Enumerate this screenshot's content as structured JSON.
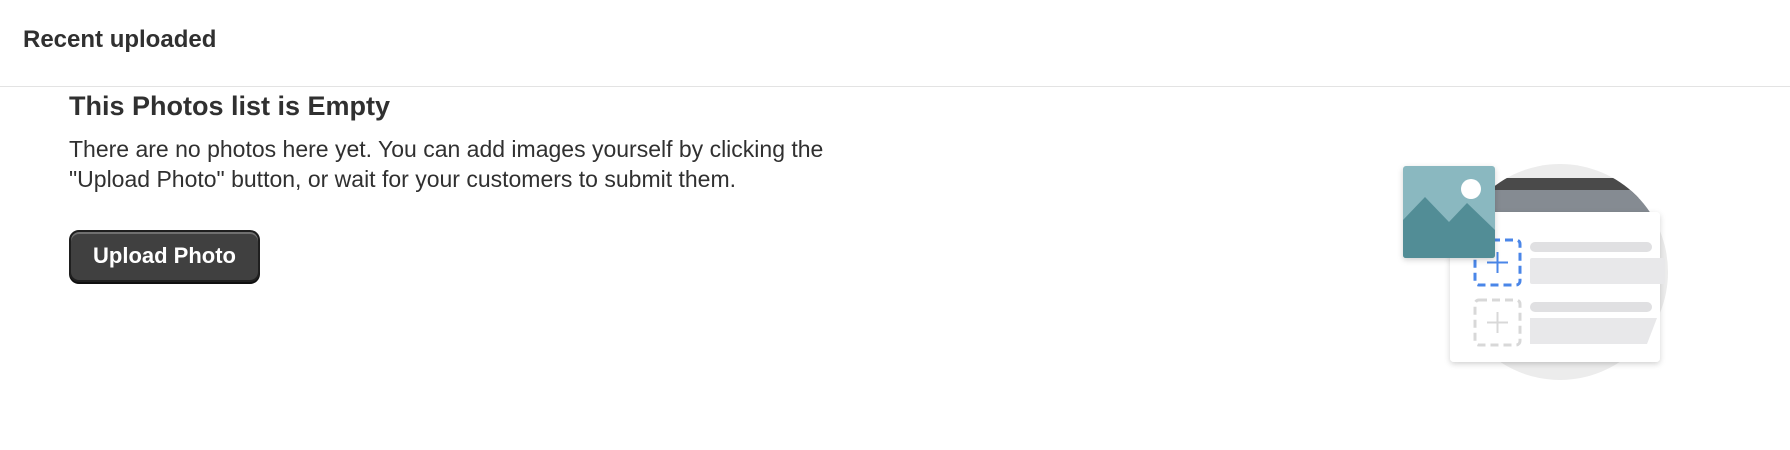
{
  "header": {
    "title": "Recent uploaded"
  },
  "empty_state": {
    "heading": "This Photos list is Empty",
    "description": "There are no photos here yet. You can add images yourself by clicking the \"Upload Photo\" button, or wait for your customers to submit them.",
    "button_label": "Upload Photo"
  },
  "colors": {
    "button_background": "#404040",
    "accent_blue": "#4a86e8",
    "photo_teal": "#8ab8c0",
    "mountain_teal": "#528d96"
  },
  "icons": {
    "illustration": "photo-upload-illustration"
  }
}
